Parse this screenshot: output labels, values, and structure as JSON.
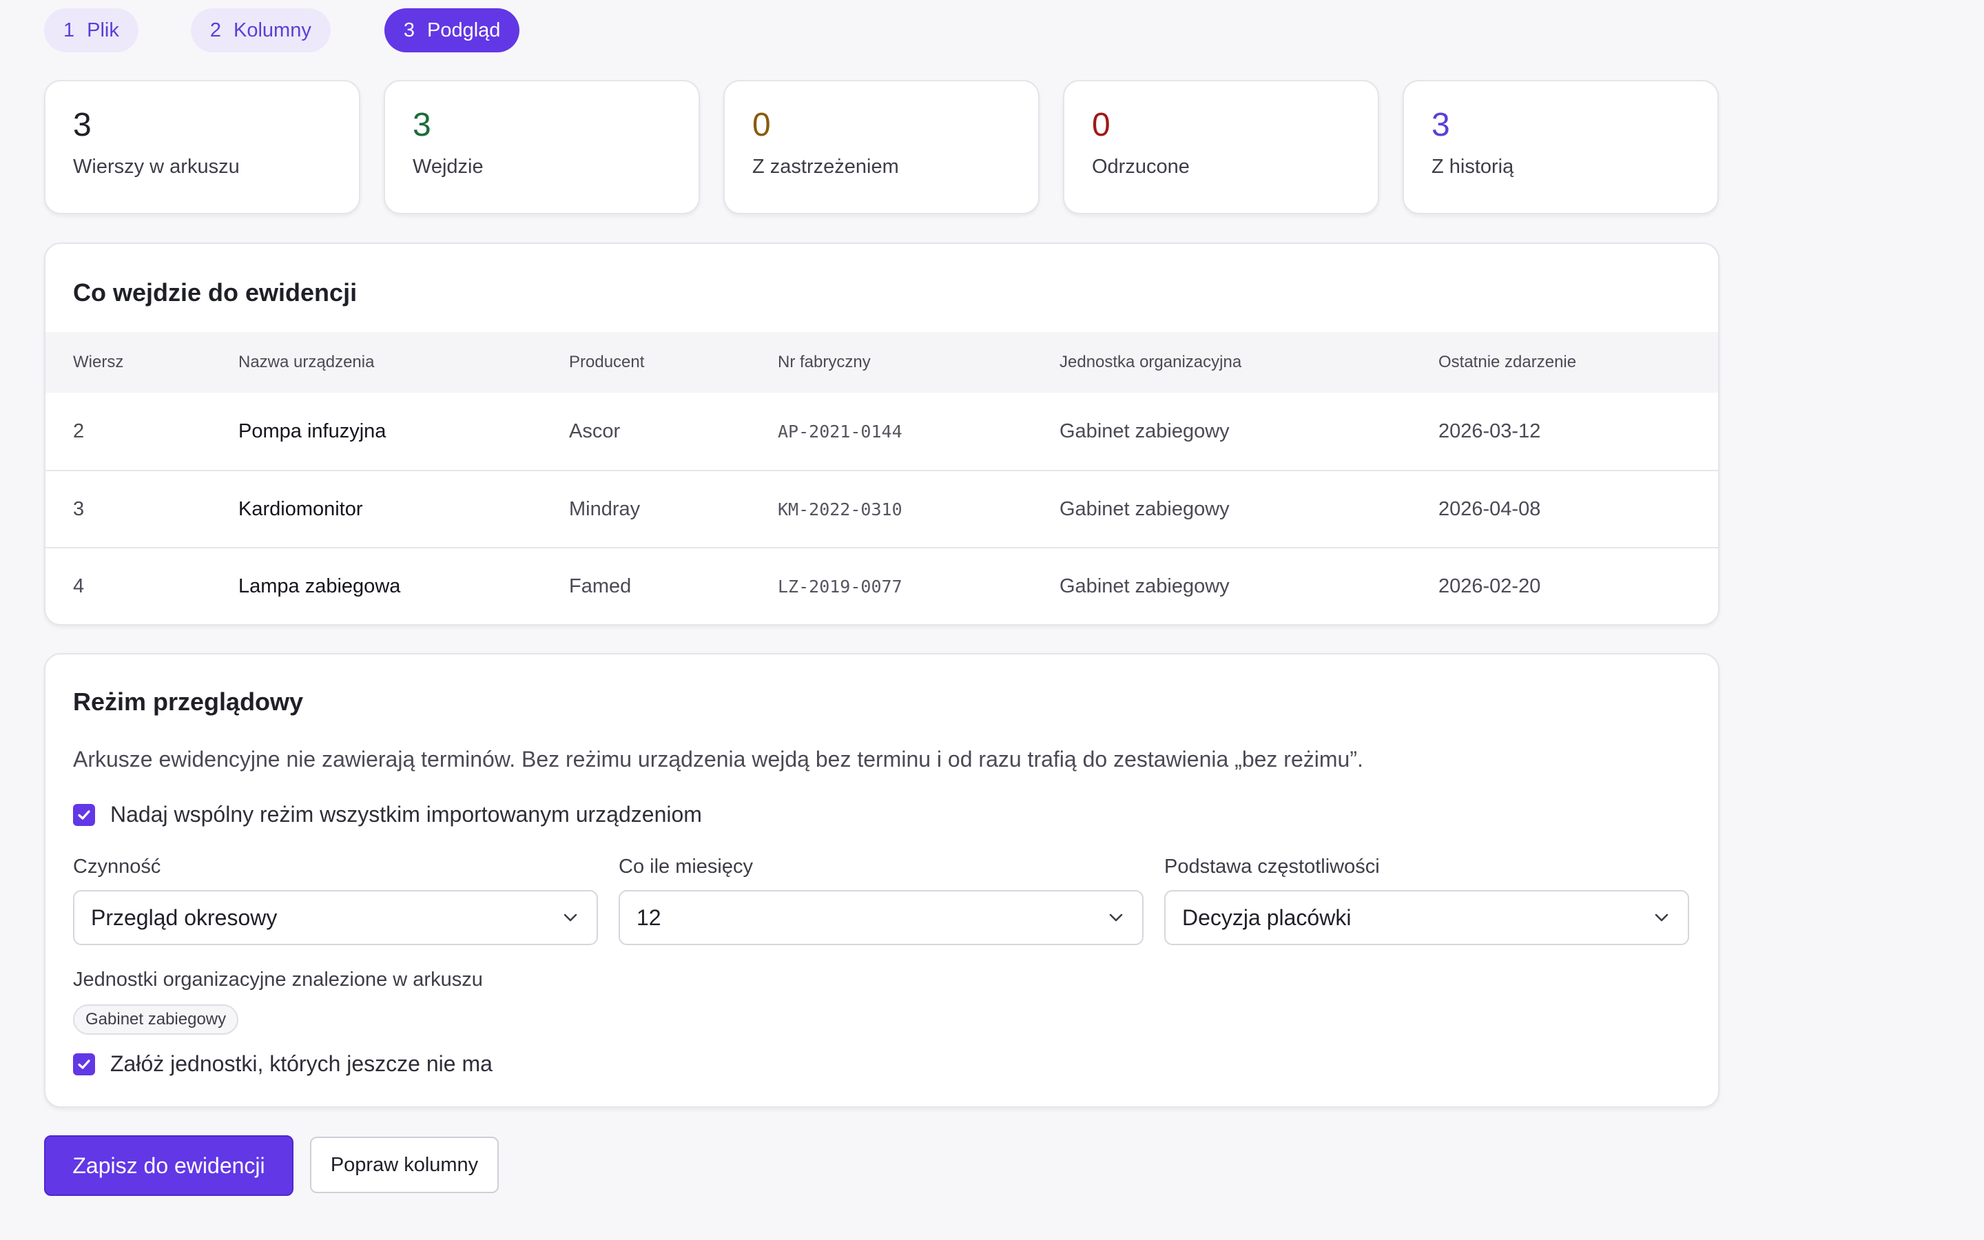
{
  "steps": [
    {
      "num": "1",
      "label": "Plik"
    },
    {
      "num": "2",
      "label": "Kolumny"
    },
    {
      "num": "3",
      "label": "Podgląd"
    }
  ],
  "stats": [
    {
      "value": "3",
      "label": "Wierszy w arkuszu",
      "color": "#1f1f28"
    },
    {
      "value": "3",
      "label": "Wejdzie",
      "color": "#1c6b3a"
    },
    {
      "value": "0",
      "label": "Z zastrzeżeniem",
      "color": "#8a5a10"
    },
    {
      "value": "0",
      "label": "Odrzucone",
      "color": "#a01818"
    },
    {
      "value": "3",
      "label": "Z historią",
      "color": "#5b3fd6"
    }
  ],
  "preview": {
    "title": "Co wejdzie do ewidencji",
    "columns": [
      "Wiersz",
      "Nazwa urządzenia",
      "Producent",
      "Nr fabryczny",
      "Jednostka organizacyjna",
      "Ostatnie zdarzenie"
    ],
    "rows": [
      [
        "2",
        "Pompa infuzyjna",
        "Ascor",
        "AP-2021-0144",
        "Gabinet zabiegowy",
        "2026-03-12"
      ],
      [
        "3",
        "Kardiomonitor",
        "Mindray",
        "KM-2022-0310",
        "Gabinet zabiegowy",
        "2026-04-08"
      ],
      [
        "4",
        "Lampa zabiegowa",
        "Famed",
        "LZ-2019-0077",
        "Gabinet zabiegowy",
        "2026-02-20"
      ]
    ]
  },
  "regime": {
    "title": "Reżim przeglądowy",
    "description": "Arkusze ewidencyjne nie zawierają terminów. Bez reżimu urządzenia wejdą bez terminu i od razu trafią do zestawienia „bez reżimu”.",
    "apply_all_label": "Nadaj wspólny reżim wszystkim importowanym urządzeniom",
    "apply_all_checked": true,
    "activity_label": "Czynność",
    "activity_value": "Przegląd okresowy",
    "interval_label": "Co ile miesięcy",
    "interval_value": "12",
    "basis_label": "Podstawa częstotliwości",
    "basis_value": "Decyzja placówki",
    "units_label": "Jednostki organizacyjne znalezione w arkuszu",
    "units": [
      "Gabinet zabiegowy"
    ],
    "create_units_label": "Załóż jednostki, których jeszcze nie ma",
    "create_units_checked": true
  },
  "actions": {
    "save_label": "Zapisz do ewidencji",
    "fix_label": "Popraw kolumny"
  },
  "colors": {
    "accent": "#6237e6"
  }
}
